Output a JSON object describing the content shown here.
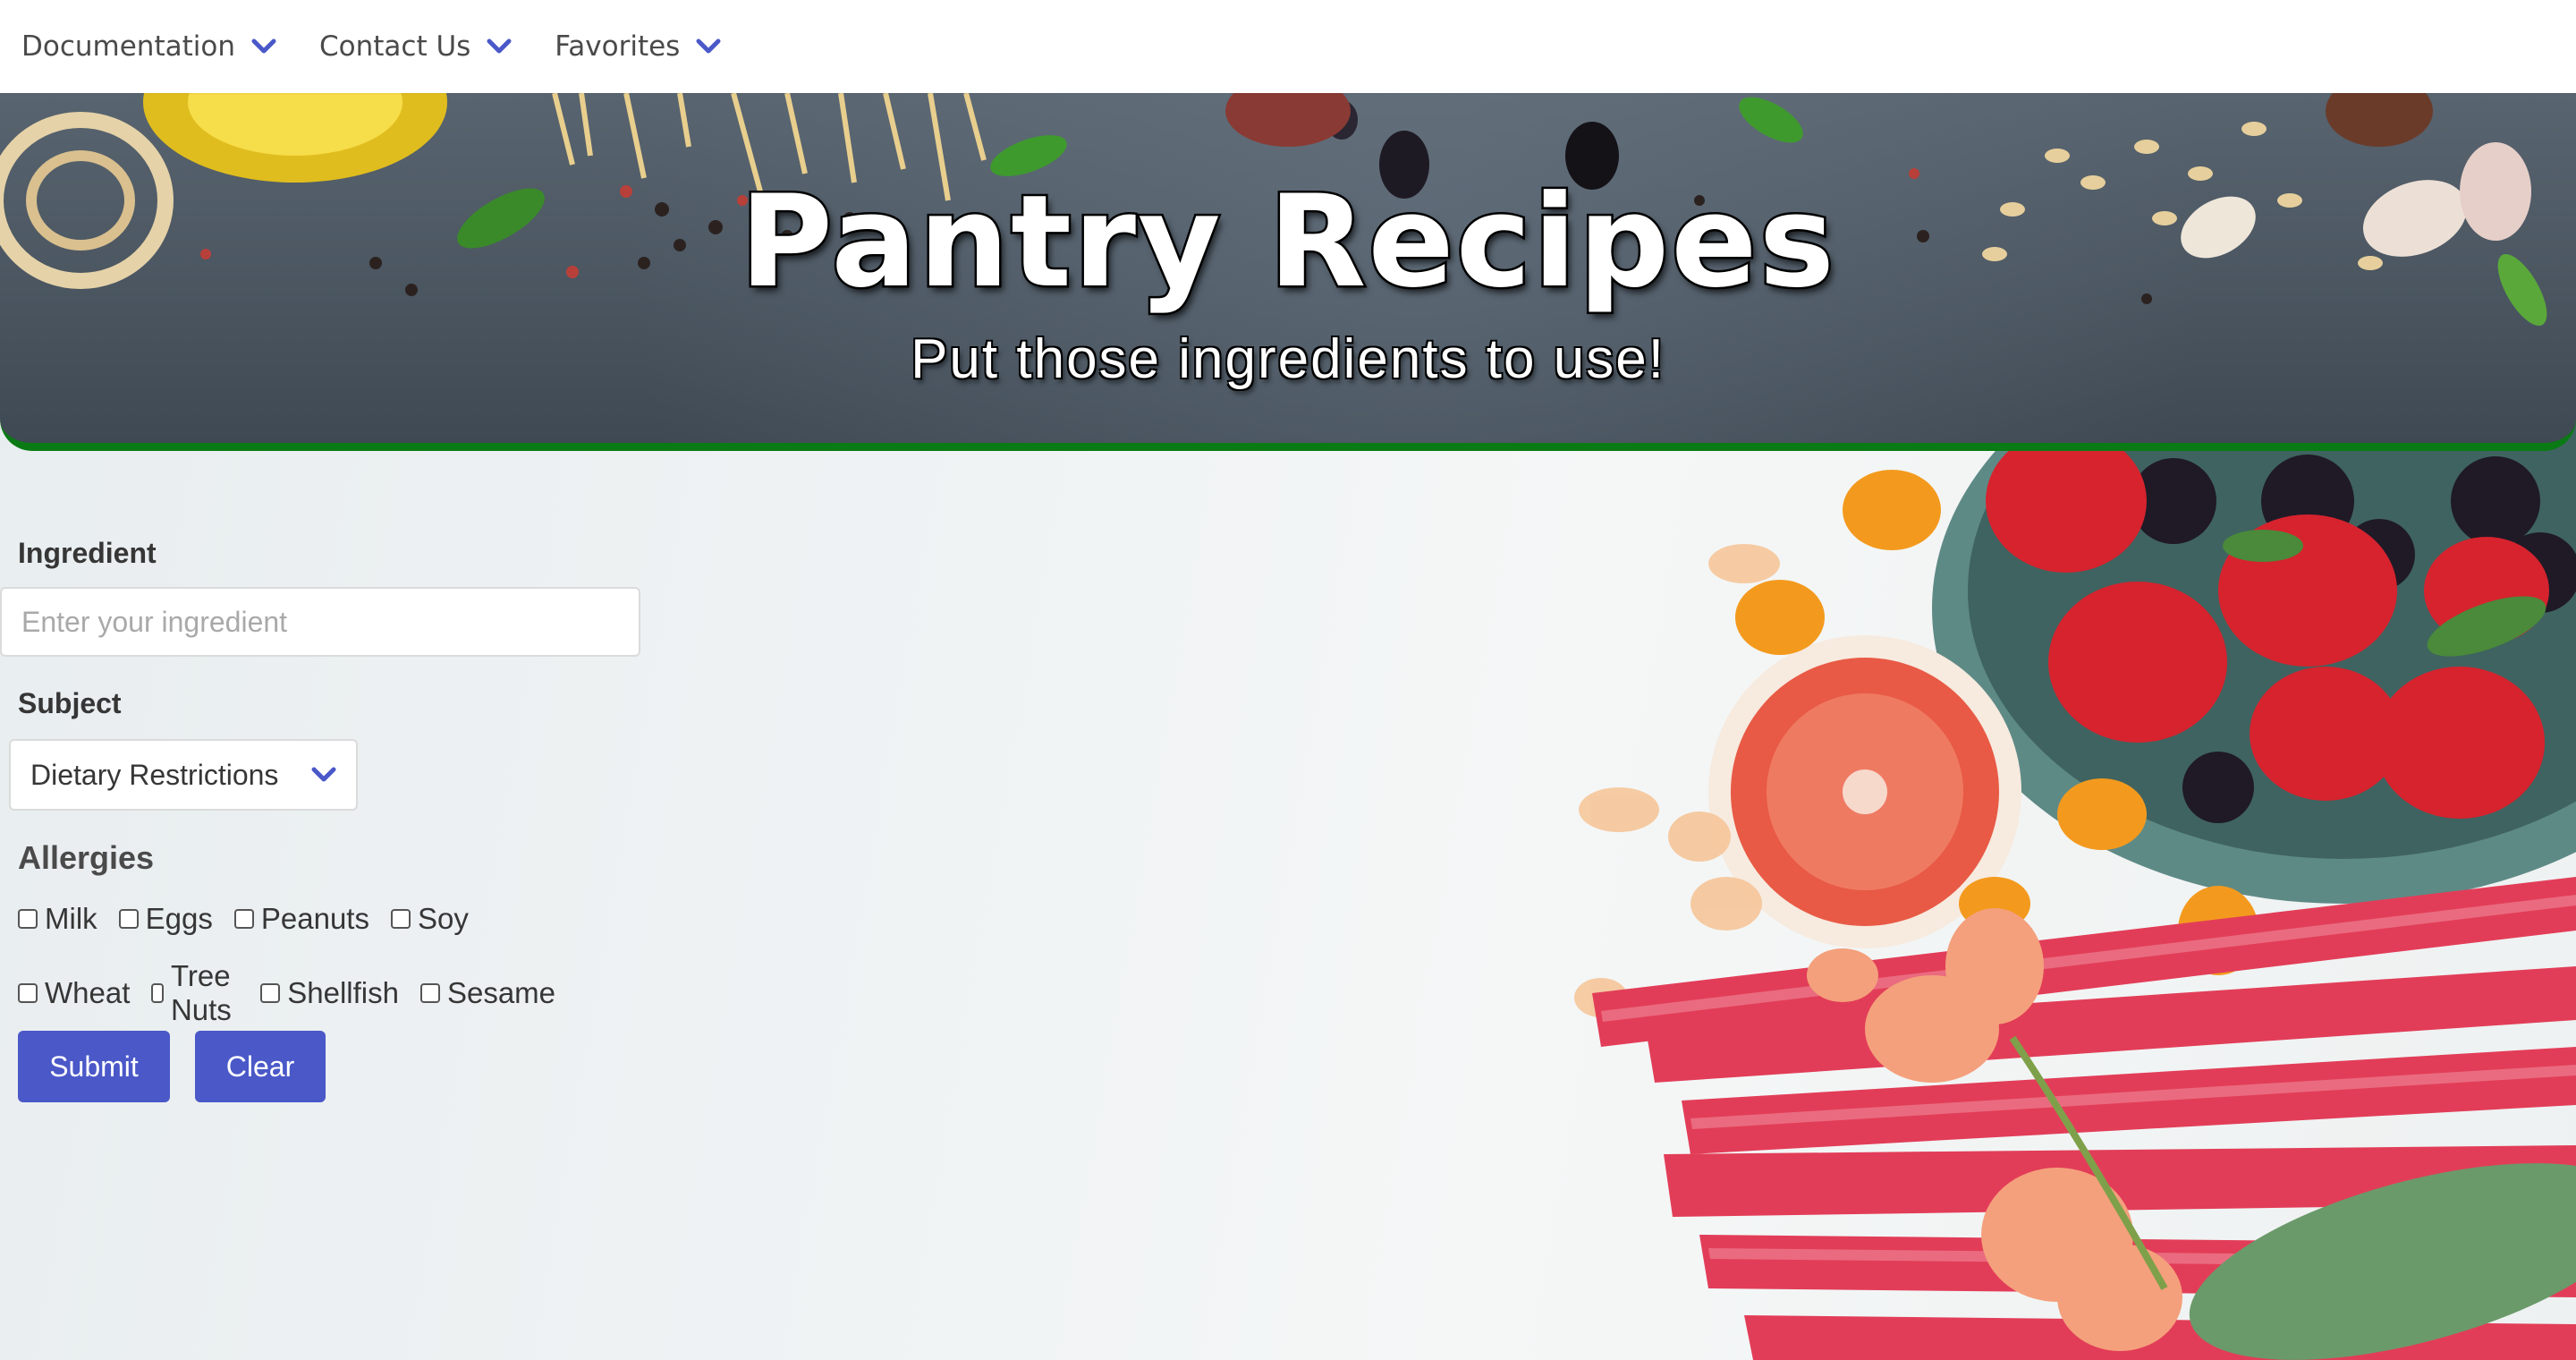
{
  "nav": {
    "items": [
      {
        "label": "Documentation",
        "icon": "chevron-down-icon"
      },
      {
        "label": "Contact Us",
        "icon": "chevron-down-icon"
      },
      {
        "label": "Favorites",
        "icon": "chevron-down-icon"
      }
    ]
  },
  "hero": {
    "title": "Pantry Recipes",
    "subtitle": "Put those ingredients to use!"
  },
  "form": {
    "ingredient_label": "Ingredient",
    "ingredient_placeholder": "Enter your ingredient",
    "ingredient_value": "",
    "subject_label": "Subject",
    "subject_selected": "Dietary Restrictions",
    "allergies_title": "Allergies",
    "allergies_row1": [
      {
        "label": "Milk",
        "checked": false
      },
      {
        "label": "Eggs",
        "checked": false
      },
      {
        "label": "Peanuts",
        "checked": false
      },
      {
        "label": "Soy",
        "checked": false
      }
    ],
    "allergies_row2": [
      {
        "label": "Wheat",
        "checked": false
      },
      {
        "label": "Tree Nuts",
        "checked": false
      },
      {
        "label": "Shellfish",
        "checked": false
      },
      {
        "label": "Sesame",
        "checked": false
      }
    ],
    "submit_label": "Submit",
    "clear_label": "Clear"
  },
  "colors": {
    "accent": "#4a58c8",
    "hero_border": "#0a7a14",
    "chevron": "#4a58c8"
  }
}
